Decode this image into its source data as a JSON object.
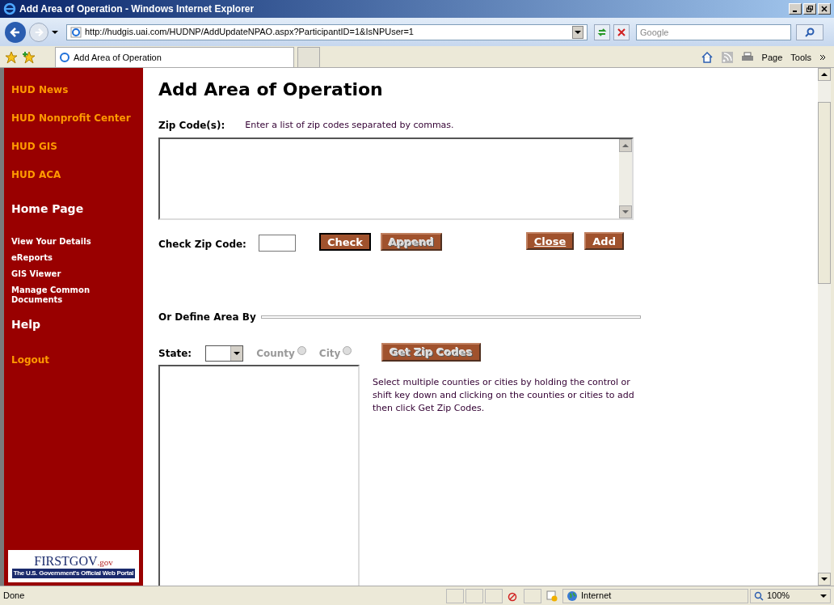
{
  "window": {
    "title": "Add Area of Operation - Windows Internet Explorer"
  },
  "address_bar": {
    "url": "http://hudgis.uai.com/HUDNP/AddUpdateNPAO.aspx?ParticipantID=1&IsNPUser=1"
  },
  "search": {
    "placeholder": "Google"
  },
  "tabs": [
    {
      "label": "Add Area of Operation",
      "selected": true
    }
  ],
  "command_bar": [
    "Page",
    "Tools"
  ],
  "sidebar": {
    "items": [
      {
        "label": "HUD News",
        "kind": "link"
      },
      {
        "label": "HUD Nonprofit Center",
        "kind": "link"
      },
      {
        "label": "HUD GIS",
        "kind": "link"
      },
      {
        "label": "HUD ACA",
        "kind": "link"
      },
      {
        "label": "Home Page",
        "kind": "section"
      },
      {
        "label": "View Your Details",
        "kind": "sub"
      },
      {
        "label": "eReports",
        "kind": "sub"
      },
      {
        "label": "GIS Viewer",
        "kind": "sub"
      },
      {
        "label": "Manage Common Documents",
        "kind": "sub"
      },
      {
        "label": "Help",
        "kind": "section"
      },
      {
        "label": "Logout",
        "kind": "link"
      }
    ],
    "logo": {
      "name": "FIRSTGOV",
      "suffix": ".gov",
      "tagline": "The U.S. Government's Official Web Portal"
    }
  },
  "page": {
    "title": "Add Area of Operation",
    "zip_label": "Zip Code(s):",
    "zip_hint": "Enter a list of zip codes separated by commas.",
    "check_label": "Check Zip Code:",
    "buttons": [
      {
        "label": "Check",
        "focused": true,
        "disabled": false,
        "hovered": false
      },
      {
        "label": "Append",
        "focused": false,
        "disabled": true,
        "hovered": false
      },
      {
        "label": "Close",
        "focused": false,
        "disabled": false,
        "hovered": true
      },
      {
        "label": "Add",
        "focused": false,
        "disabled": false,
        "hovered": false
      }
    ],
    "define_heading": "Or Define Area By",
    "state_label": "State:",
    "radios": [
      {
        "label": "County",
        "checked": false,
        "disabled": true
      },
      {
        "label": "City",
        "checked": false,
        "disabled": true
      }
    ],
    "get_zip_button": {
      "label": "Get Zip Codes",
      "disabled": true
    },
    "help_text": "Select multiple counties or cities by holding the control or shift key down and clicking on the counties or cities to add then click Get Zip Codes."
  },
  "status_bar": {
    "status": "Done",
    "zone": "Internet",
    "zoom": "100%"
  }
}
